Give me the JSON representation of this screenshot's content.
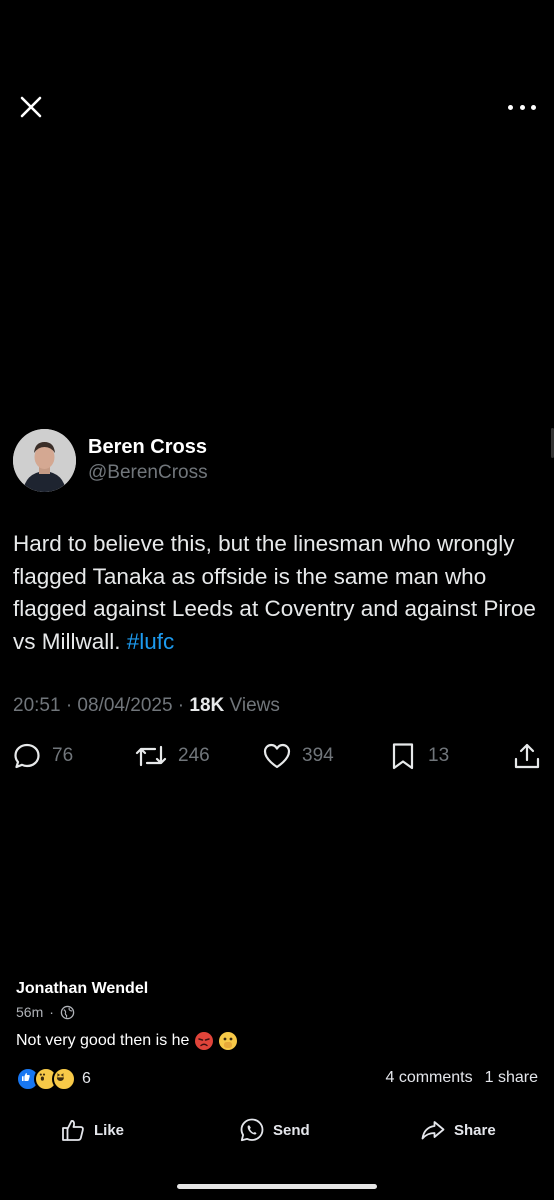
{
  "header": {
    "close_icon": "close-icon",
    "more_icon": "more-horizontal-icon"
  },
  "tweet": {
    "author_name": "Beren Cross",
    "author_handle": "@BerenCross",
    "text_main": "Hard to believe this, but the linesman who wrongly flagged Tanaka as offside is the same man who flagged against Leeds at Coventry and against Piroe vs Millwall. ",
    "hashtag": "#lufc",
    "time": "20:51 · 08/04/2025 · ",
    "views_count": "18K",
    "views_label": " Views",
    "replies": "76",
    "retweets": "246",
    "likes": "394",
    "bookmarks": "13"
  },
  "facebook": {
    "commenter_name": "Jonathan Wendel",
    "comment_time": "56m",
    "comment_dot": "·",
    "comment_text": "Not very good then is he",
    "reactions_count": "6",
    "comments_label": "4 comments",
    "shares_label": "1 share",
    "like_label": "Like",
    "send_label": "Send",
    "share_label": "Share"
  },
  "colors": {
    "accent": "#1d9bf0",
    "muted": "#71767b",
    "background": "#000000"
  }
}
